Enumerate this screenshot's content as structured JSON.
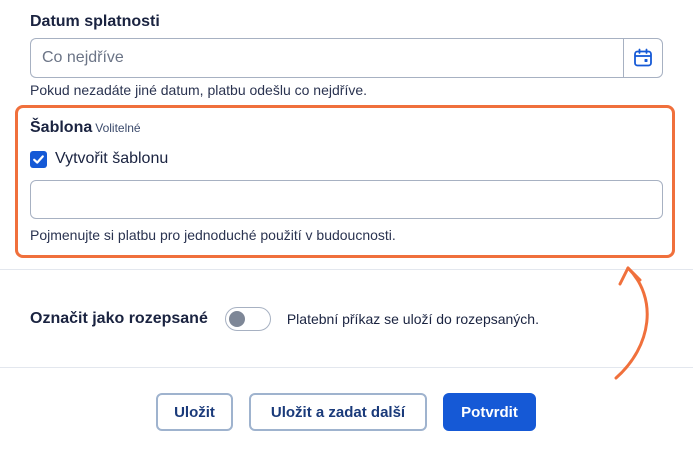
{
  "due_date": {
    "label": "Datum splatnosti",
    "placeholder": "Co nejdříve",
    "hint": "Pokud nezadáte jiné datum, platbu odešlu co nejdříve."
  },
  "template": {
    "label": "Šablona",
    "optional": "Volitelné",
    "checkbox_label": "Vytvořit šablonu",
    "checked": true,
    "name_value": "",
    "hint": "Pojmenujte si platbu pro jednoduché použití v budoucnosti."
  },
  "draft": {
    "label": "Označit jako rozepsané",
    "description": "Platební příkaz se uloží do rozepsaných.",
    "enabled": false
  },
  "actions": {
    "save": "Uložit",
    "save_and_next": "Uložit a zadat další",
    "confirm": "Potvrdit"
  },
  "colors": {
    "accent": "#1559d6",
    "highlight": "#f0703c"
  }
}
